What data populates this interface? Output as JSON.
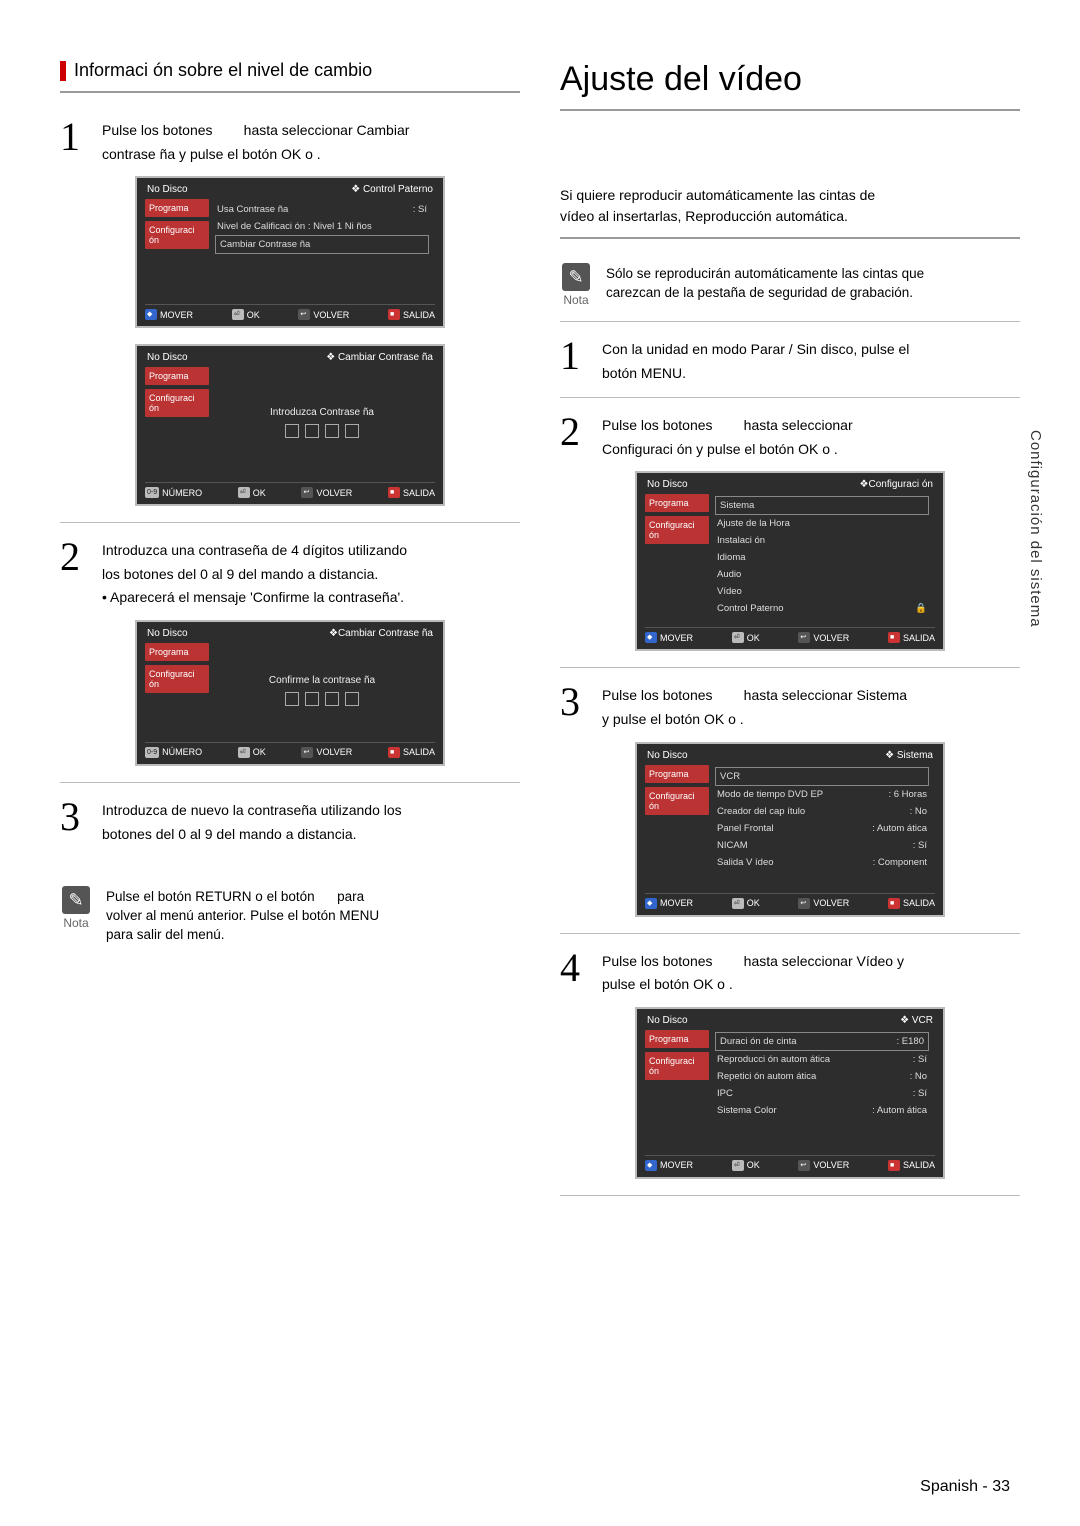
{
  "side_tab_text": "Configuración del sistema",
  "footer": "Spanish - 33",
  "left": {
    "heading": "Informaci ón sobre el nivel de cambio",
    "step1": {
      "line1": "Pulse los botones",
      "line1b": "hasta seleccionar Cambiar",
      "line2": "contrase ña y pulse el botón OK o  ."
    },
    "step2": {
      "line1": "Introduzca una contraseña de 4 dígitos utilizando",
      "line2": "los botones del 0 al 9 del mando a distancia.",
      "line3": "• Aparecerá el mensaje 'Confirme la contraseña'."
    },
    "step3": {
      "line1": "Introduzca de nuevo la contraseña utilizando los",
      "line2": "botones del 0 al 9 del mando a distancia."
    },
    "nota": {
      "label": "Nota",
      "text1": "Pulse el botón RETURN o el botón",
      "text1b": "para",
      "text2": "volver al menú anterior. Pulse el botón MENU",
      "text3": "para salir del menú."
    },
    "osd1": {
      "no_disco": "No Disco",
      "title": "❖ Control Paterno",
      "side1": "Programa",
      "side2": "Configuraci ón",
      "row1_l": "Usa Contrase ña",
      "row1_r": ": Sí",
      "row2": "Nivel de Calificaci ón : Nivel 1 Ni ños",
      "row3": "Cambiar Contrase ña",
      "btm_mover": "MOVER",
      "btm_ok": "OK",
      "btm_volver": "VOLVER",
      "btm_salida": "SALIDA"
    },
    "osd1b": {
      "no_disco": "No Disco",
      "title": "❖ Cambiar Contrase ña",
      "side1": "Programa",
      "side2": "Configuraci ón",
      "center": "Introduzca Contrase ña",
      "btm_numero": "NÚMERO",
      "btm_ok": "OK",
      "btm_volver": "VOLVER",
      "btm_salida": "SALIDA"
    },
    "osd2": {
      "no_disco": "No Disco",
      "title": "❖Cambiar Contrase ña",
      "side1": "Programa",
      "side2": "Configuraci ón",
      "center": "Confirme la contrase ña",
      "btm_numero": "NÚMERO",
      "btm_ok": "OK",
      "btm_volver": "VOLVER",
      "btm_salida": "SALIDA"
    }
  },
  "right": {
    "title": "Ajuste del vídeo",
    "intro1": "Si quiere reproducir automáticamente las cintas de",
    "intro2": "vídeo al insertarlas, Reproducción automática.",
    "nota": {
      "label": "Nota",
      "text1": "Sólo se reproducirán automáticamente las cintas que",
      "text2": "carezcan de la pestaña de seguridad de grabación."
    },
    "step1": {
      "line1": "Con la unidad en modo Parar / Sin disco, pulse el",
      "line2": "botón MENU."
    },
    "step2": {
      "line1": "Pulse los botones",
      "line1b": "hasta seleccionar",
      "line2": "Configuraci ón y pulse el botón OK o  ."
    },
    "step3": {
      "line1": "Pulse los botones",
      "line1b": "hasta seleccionar Sistema",
      "line2": "y pulse el botón OK o  ."
    },
    "step4": {
      "line1": "Pulse los botones",
      "line1b": "hasta seleccionar Vídeo y",
      "line2": "pulse el botón OK o  ."
    },
    "osd2": {
      "no_disco": "No Disco",
      "title": "❖Configuraci ón",
      "side1": "Programa",
      "side2": "Configuraci ón",
      "items": [
        "Sistema",
        "Ajuste de la Hora",
        "Instalaci ón",
        "Idioma",
        "Audio",
        "Vídeo",
        "Control Paterno"
      ],
      "lock": "🔒",
      "btm_mover": "MOVER",
      "btm_ok": "OK",
      "btm_volver": "VOLVER",
      "btm_salida": "SALIDA"
    },
    "osd3": {
      "no_disco": "No Disco",
      "title": "❖ Sistema",
      "side1": "Programa",
      "side2": "Configuraci ón",
      "rows": [
        {
          "l": "VCR",
          "r": ""
        },
        {
          "l": "Modo de tiempo DVD EP",
          "r": ": 6 Horas"
        },
        {
          "l": "Creador del cap ítulo",
          "r": ": No"
        },
        {
          "l": "Panel Frontal",
          "r": ": Autom ática"
        },
        {
          "l": "NICAM",
          "r": ": Sí"
        },
        {
          "l": "Salida V ídeo",
          "r": ": Component"
        }
      ],
      "btm_mover": "MOVER",
      "btm_ok": "OK",
      "btm_volver": "VOLVER",
      "btm_salida": "SALIDA"
    },
    "osd4": {
      "no_disco": "No Disco",
      "title": "❖  VCR",
      "side1": "Programa",
      "side2": "Configuraci ón",
      "rows": [
        {
          "l": "Duraci ón de cinta",
          "r": ": E180"
        },
        {
          "l": "Reproducci ón autom ática",
          "r": ": Sí"
        },
        {
          "l": "Repetici ón autom ática",
          "r": ": No"
        },
        {
          "l": "IPC",
          "r": ": Sí"
        },
        {
          "l": "Sistema Color",
          "r": ": Autom ática"
        }
      ],
      "btm_mover": "MOVER",
      "btm_ok": "OK",
      "btm_volver": "VOLVER",
      "btm_salida": "SALIDA"
    }
  }
}
